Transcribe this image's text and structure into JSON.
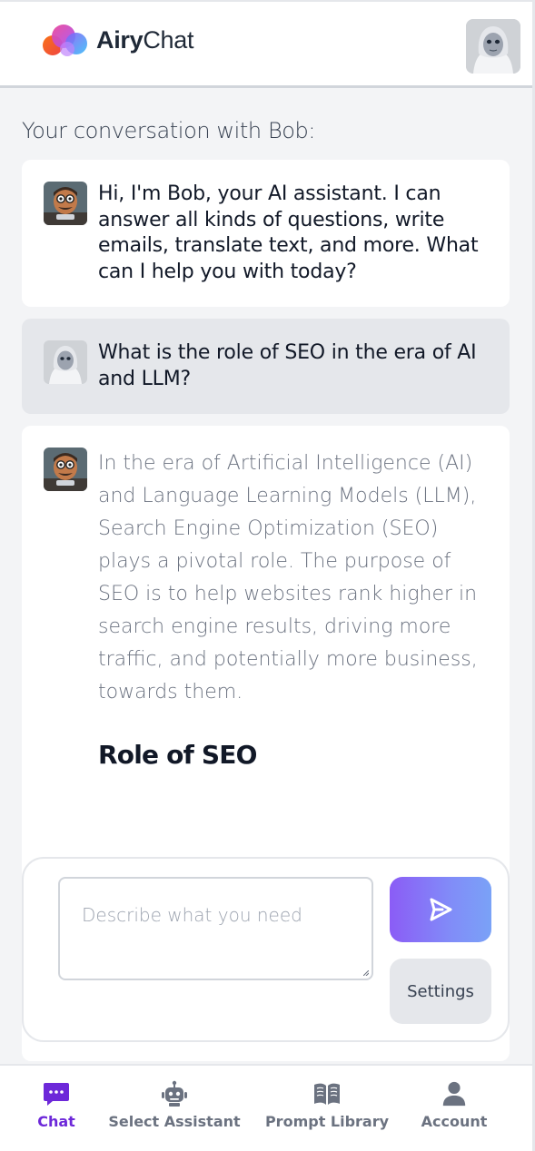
{
  "app": {
    "name_bold": "Airy",
    "name_light": "Chat"
  },
  "conversation": {
    "title": "Your conversation with Bob:",
    "messages": [
      {
        "role": "assistant",
        "text": "Hi, I'm Bob, your AI assistant. I can answer all kinds of questions, write emails, translate text, and more. What can I help you with today?"
      },
      {
        "role": "user",
        "text": "What is the role of SEO in the era of AI and LLM?"
      },
      {
        "role": "assistant",
        "text": "In the era of Artificial Intelligence (AI) and Language Learning Models (LLM), Search Engine Optimization (SEO) plays a pivotal role. The purpose of SEO is to help websites rank higher in search engine results, driving more traffic, and potentially more business, towards them.",
        "heading": "Role of SEO"
      }
    ]
  },
  "composer": {
    "placeholder": "Describe what you need",
    "value": "",
    "send_icon": "send-icon",
    "settings_label": "Settings"
  },
  "nav": {
    "items": [
      {
        "label": "Chat",
        "icon": "chat-bubble-icon",
        "active": true
      },
      {
        "label": "Select Assistant",
        "icon": "robot-icon",
        "active": false
      },
      {
        "label": "Prompt Library",
        "icon": "book-icon",
        "active": false
      },
      {
        "label": "Account",
        "icon": "user-icon",
        "active": false
      }
    ]
  },
  "colors": {
    "accent": "#6d28d9",
    "send_gradient_start": "#8b5cf6",
    "send_gradient_end": "#7aa2f7",
    "background": "#f3f4f6"
  }
}
